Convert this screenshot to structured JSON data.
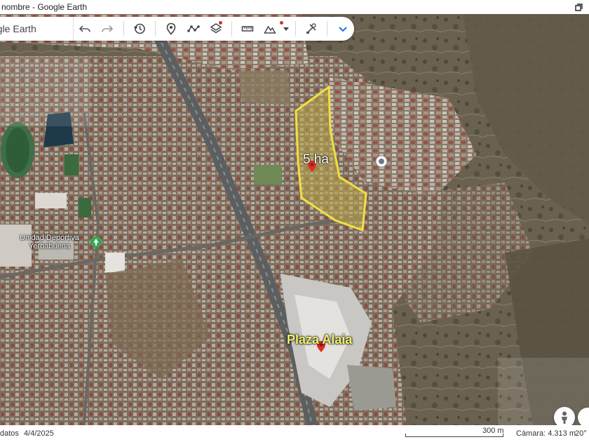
{
  "window": {
    "title": "nombre - Google Earth"
  },
  "search": {
    "text": "ogle Earth"
  },
  "toolbar": {
    "buttons": [
      {
        "name": "undo-button",
        "icon": "undo-icon"
      },
      {
        "name": "redo-button",
        "icon": "redo-icon"
      },
      {
        "name": "historical-imagery-button",
        "icon": "history-icon"
      },
      {
        "name": "add-placemark-button",
        "icon": "placemark-icon"
      },
      {
        "name": "add-path-button",
        "icon": "path-icon"
      },
      {
        "name": "layers-button",
        "icon": "layers-icon"
      },
      {
        "name": "measure-button",
        "icon": "ruler-icon"
      },
      {
        "name": "map-style-button",
        "icon": "terrain-icon"
      },
      {
        "name": "projects-button",
        "icon": "tools-icon"
      },
      {
        "name": "more-button",
        "icon": "chevron-down-icon"
      }
    ]
  },
  "map": {
    "labels": {
      "area": "5 ha",
      "plaza": "Plaza Alaia",
      "unidad_line1": "Unidad Deportiva",
      "unidad_line2": "Yerbabuena"
    },
    "colors": {
      "polygon_stroke": "#f0e040",
      "polygon_fill": "#b9a94a",
      "pin": "#d93025",
      "plaza_label": "#f2f26a",
      "park_icon": "#34a853"
    }
  },
  "status": {
    "datos": "datos",
    "date": "4/4/2025",
    "scale": "300 m",
    "camera": "Cámara: 4.313 m",
    "elevation": "20°"
  }
}
